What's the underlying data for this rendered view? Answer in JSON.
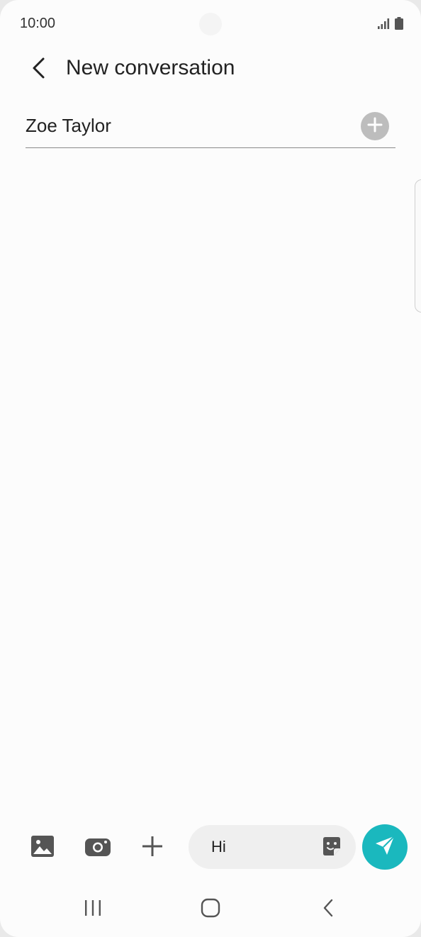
{
  "status_bar": {
    "time": "10:00",
    "icons": [
      "signal-icon",
      "battery-icon"
    ]
  },
  "app_bar": {
    "title": "New conversation",
    "back_icon": "chevron-left-icon"
  },
  "recipient": {
    "value": "Zoe Taylor",
    "add_icon": "plus-circle-icon"
  },
  "composer": {
    "tools": [
      "gallery-icon",
      "camera-icon",
      "plus-icon"
    ],
    "message_value": "Hi",
    "sticker_icon": "sticker-icon",
    "send_icon": "send-icon"
  },
  "nav_bar": {
    "icons": [
      "recent-apps-icon",
      "home-icon",
      "back-icon"
    ]
  },
  "colors": {
    "accent": "#1ab8be",
    "background": "#fcfcfc",
    "field": "#efefef",
    "icon_dark": "#555555",
    "add_circle": "#bdbdbd"
  }
}
